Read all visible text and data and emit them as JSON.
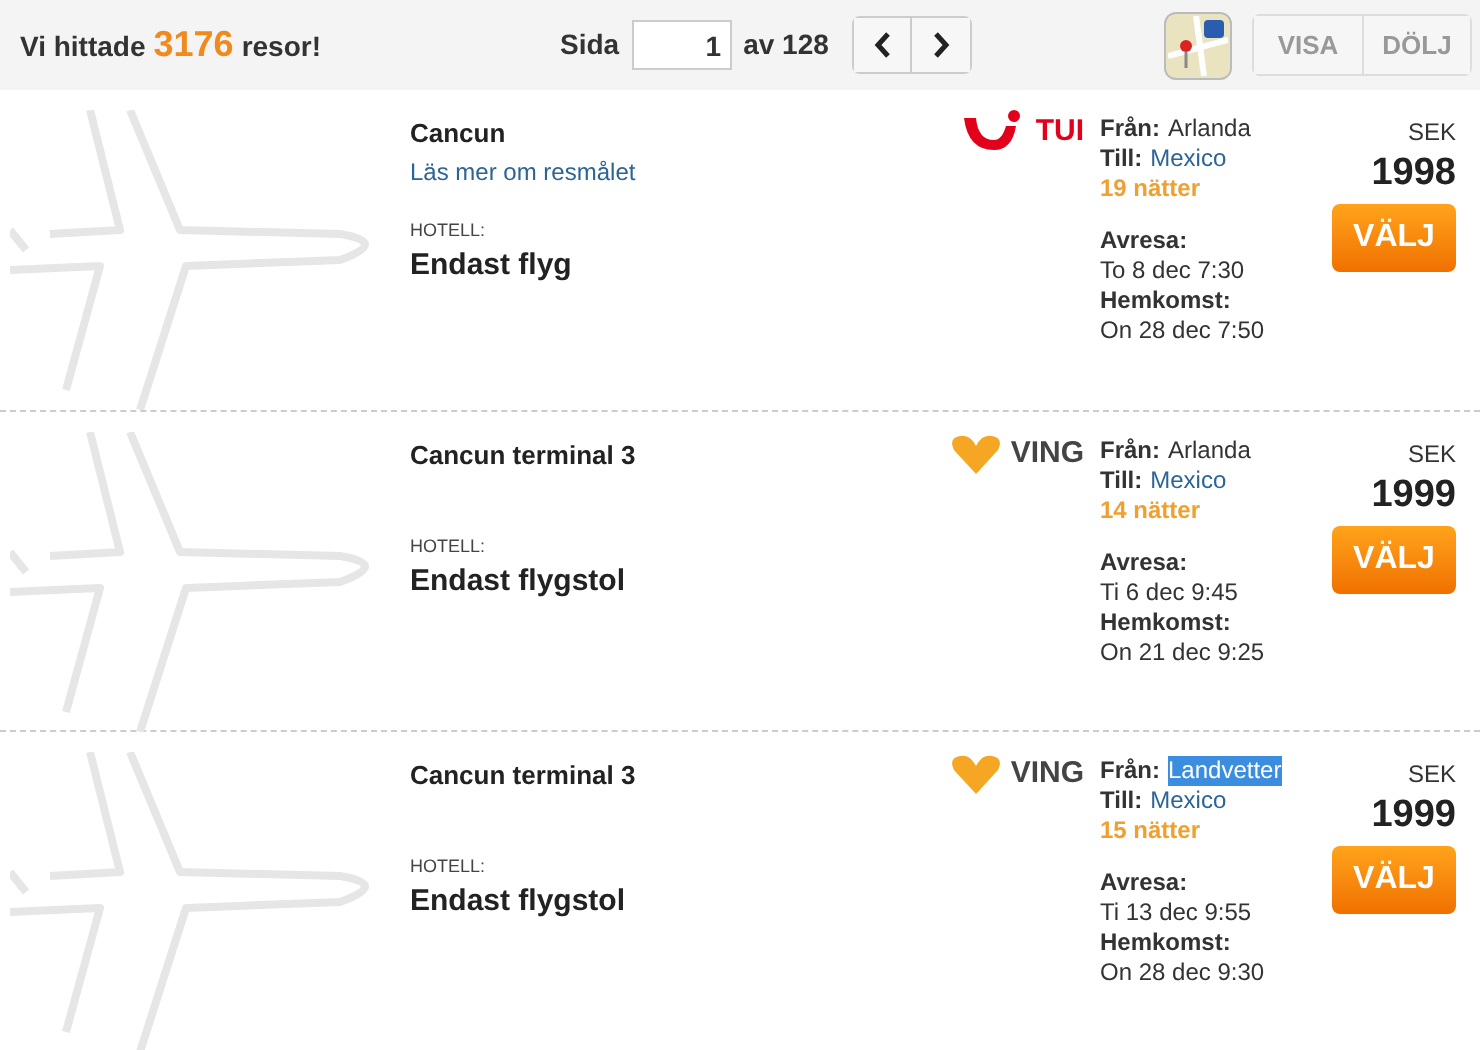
{
  "header": {
    "found_prefix": "Vi hittade",
    "found_count": "3176",
    "found_suffix": "resor!",
    "page_label": "Sida",
    "page_value": "1",
    "page_total": "av 128",
    "buttons": [
      {
        "label": "VISA",
        "disabled": true
      },
      {
        "label": "DÖLJ",
        "disabled": true
      }
    ]
  },
  "results": [
    {
      "destination": "Cancun",
      "link": "Läs mer om resmålet",
      "hotel_label": "HOTELL:",
      "hotel": "Endast flyg",
      "operator": {
        "kind": "tui",
        "name": "TUI"
      },
      "from_label": "Från:",
      "from": "Arlanda",
      "from_selected": false,
      "to_label": "Till:",
      "to": "Mexico",
      "nights": "19 nätter",
      "depart_label": "Avresa:",
      "depart": "To 8 dec 7:30",
      "return_label": "Hemkomst:",
      "return": "On 28 dec 7:50",
      "currency": "SEK",
      "price": "1998",
      "button": "VÄLJ"
    },
    {
      "destination": "Cancun terminal 3",
      "hotel_label": "HOTELL:",
      "hotel": "Endast flygstol",
      "operator": {
        "kind": "ving",
        "name": "VING"
      },
      "from_label": "Från:",
      "from": "Arlanda",
      "from_selected": false,
      "to_label": "Till:",
      "to": "Mexico",
      "nights": "14 nätter",
      "depart_label": "Avresa:",
      "depart": "Ti 6 dec 9:45",
      "return_label": "Hemkomst:",
      "return": "On 21 dec 9:25",
      "currency": "SEK",
      "price": "1999",
      "button": "VÄLJ"
    },
    {
      "destination": "Cancun terminal 3",
      "hotel_label": "HOTELL:",
      "hotel": "Endast flygstol",
      "operator": {
        "kind": "ving",
        "name": "VING"
      },
      "from_label": "Från:",
      "from": "Landvetter",
      "from_selected": true,
      "to_label": "Till:",
      "to": "Mexico",
      "nights": "15 nätter",
      "depart_label": "Avresa:",
      "depart": "Ti 13 dec 9:55",
      "return_label": "Hemkomst:",
      "return": "On 28 dec 9:30",
      "currency": "SEK",
      "price": "1999",
      "button": "VÄLJ"
    }
  ]
}
